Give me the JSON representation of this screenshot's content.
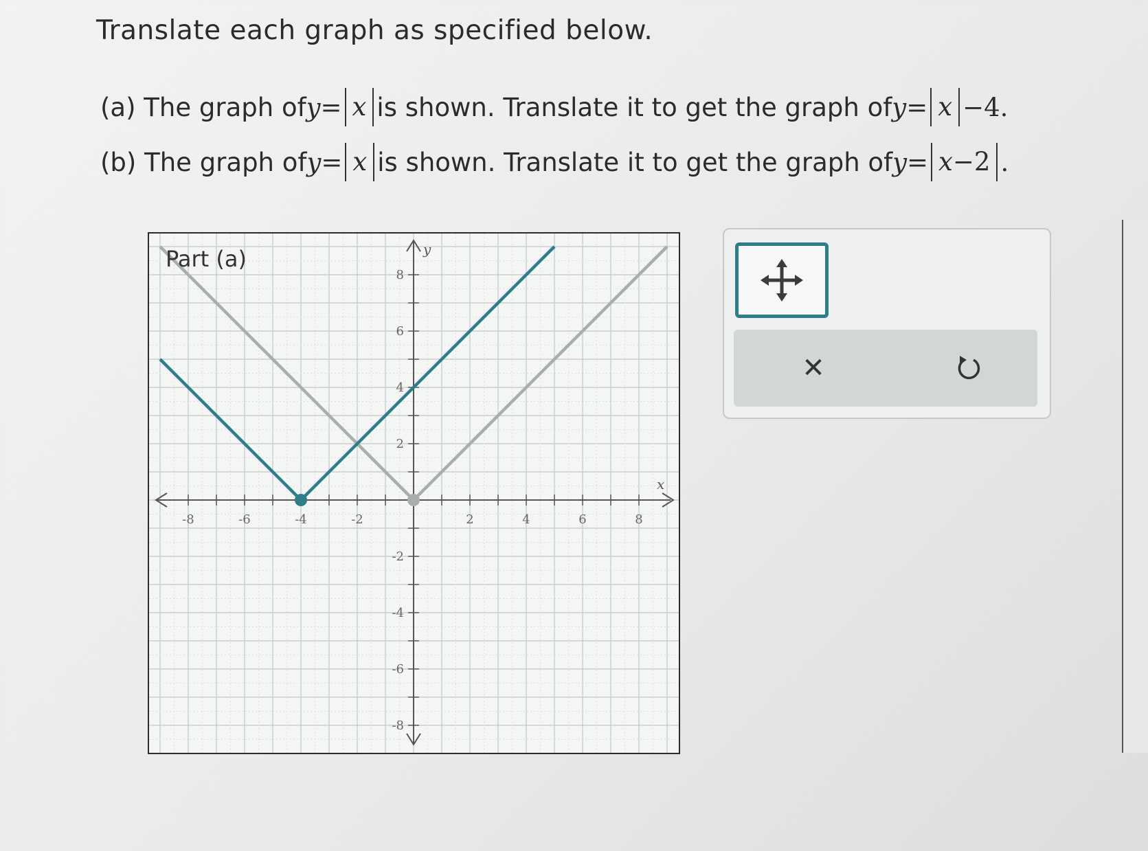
{
  "title": "Translate each graph as specified below.",
  "part_a": {
    "prefix": "(a) The graph of ",
    "middle": " is shown. Translate it to get the graph of ",
    "given": {
      "lhs": "y",
      "eq": "=",
      "inner": "x"
    },
    "target": {
      "lhs": "y",
      "eq": "=",
      "inner": "x",
      "tail": "−4",
      "end": "."
    }
  },
  "part_b": {
    "prefix": "(b) The graph of ",
    "middle": " is shown. Translate it to get the graph of ",
    "given": {
      "lhs": "y",
      "eq": "=",
      "inner": "x"
    },
    "target": {
      "lhs": "y",
      "eq": "=",
      "inner_var": "x",
      "inner_rest": "−2",
      "end": "."
    }
  },
  "graph": {
    "panel_label": "Part (a)",
    "x_axis_label": "x",
    "y_axis_label": "y",
    "x_ticks": [
      "-8",
      "-6",
      "-4",
      "-2",
      "2",
      "4",
      "6",
      "8"
    ],
    "y_ticks": [
      "8",
      "6",
      "4",
      "2",
      "-2",
      "-4",
      "-6",
      "-8"
    ]
  },
  "chart_data": {
    "type": "line",
    "xlim": [
      -9,
      9
    ],
    "ylim": [
      -9,
      9
    ],
    "grid": true,
    "series": [
      {
        "points": [
          [
            -9,
            9
          ],
          [
            0,
            0
          ],
          [
            9,
            9
          ]
        ],
        "vertex": [
          0,
          0
        ],
        "color": "#a9adad"
      },
      {
        "points": [
          [
            -9,
            5
          ],
          [
            -4,
            0
          ],
          [
            5,
            9
          ]
        ],
        "vertex": [
          -4,
          0
        ],
        "color": "#2e7d8a"
      }
    ]
  },
  "tools": {
    "move_icon": "move-arrows-icon",
    "clear_icon": "close-icon",
    "undo_icon": "undo-icon",
    "accent_color": "#2e7d8a",
    "clear_glyph": "✕"
  }
}
